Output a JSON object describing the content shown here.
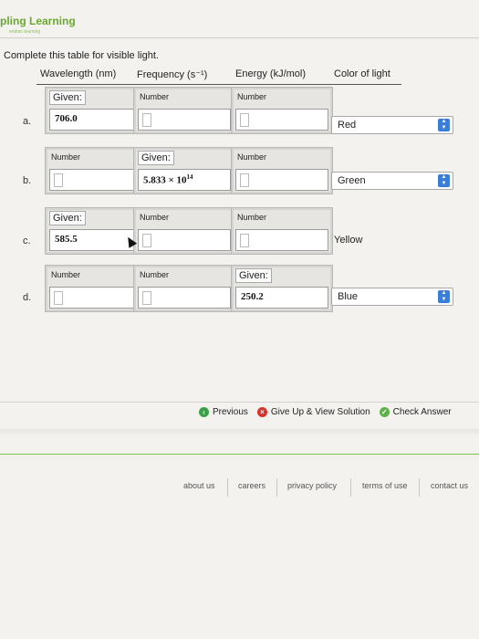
{
  "brand": {
    "title": "pling Learning",
    "subtitle": "endian learning"
  },
  "instructions": "Complete this table for visible light.",
  "columns": {
    "wavelength": "Wavelength (nm)",
    "frequency": "Frequency (s⁻¹)",
    "energy": "Energy (kJ/mol)",
    "color": "Color of light"
  },
  "rows": {
    "a": {
      "letter": "a.",
      "wavelength": {
        "label": "Given:",
        "value": "706.0"
      },
      "frequency": {
        "label": "Number"
      },
      "energy": {
        "label": "Number"
      },
      "color": "Red"
    },
    "b": {
      "letter": "b.",
      "wavelength": {
        "label": "Number"
      },
      "frequency": {
        "label": "Given:",
        "mantissa": "5.833 × 10",
        "exponent": "14"
      },
      "energy": {
        "label": "Number"
      },
      "color": "Green"
    },
    "c": {
      "letter": "c.",
      "wavelength": {
        "label": "Given:",
        "value": "585.5"
      },
      "frequency": {
        "label": "Number"
      },
      "energy": {
        "label": "Number"
      },
      "color": "Yellow"
    },
    "d": {
      "letter": "d.",
      "wavelength": {
        "label": "Number"
      },
      "frequency": {
        "label": "Number"
      },
      "energy": {
        "label": "Given:",
        "value": "250.2"
      },
      "color": "Blue"
    }
  },
  "actions": {
    "previous": "Previous",
    "give_up": "Give Up & View Solution",
    "check": "Check Answer"
  },
  "footer": {
    "about": "about us",
    "careers": "careers",
    "privacy": "privacy policy",
    "terms": "terms of use",
    "contact": "contact us"
  },
  "icons": {
    "previous": "arrow-left-circle-icon",
    "give_up": "x-circle-icon",
    "check": "checkmark-circle-icon",
    "select": "chevron-updown-icon"
  },
  "colors": {
    "brand": "#6aa82f",
    "select_accent": "#3b7ed8"
  }
}
